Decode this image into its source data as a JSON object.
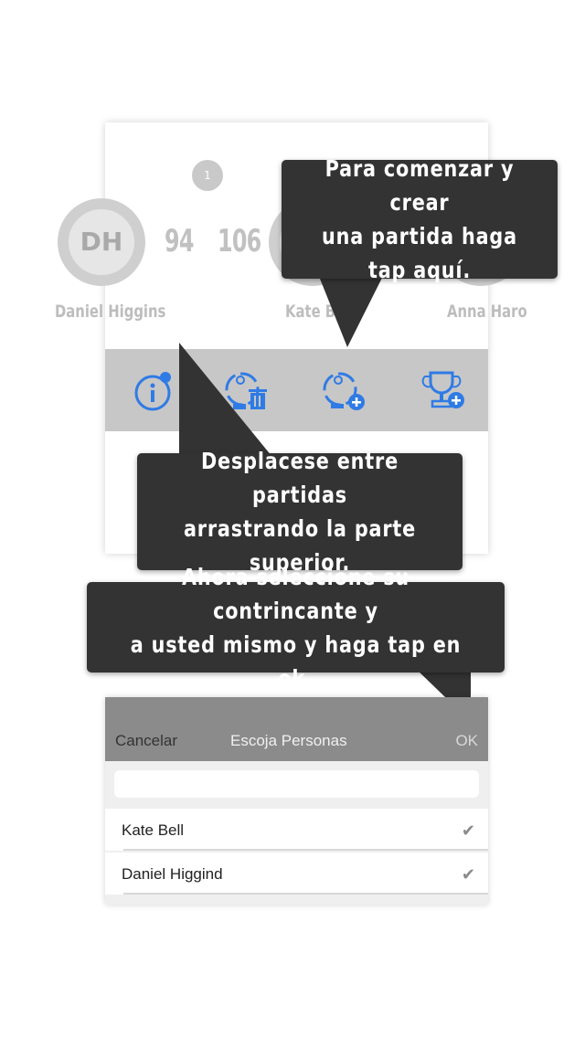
{
  "game": {
    "badge": "1",
    "players": [
      {
        "initials": "DH",
        "name": "Daniel Higgins"
      },
      {
        "initials": "",
        "name": "Kate Bell"
      },
      {
        "initials": "",
        "name": "Anna Haro"
      }
    ],
    "scores": [
      "94",
      "106"
    ]
  },
  "toolbar": {
    "icons": [
      "info-icon",
      "delete-game-icon",
      "add-game-icon",
      "add-trophy-icon"
    ],
    "accent": "#2f7be5"
  },
  "tips": {
    "create": "Para comenzar y crear\nuna partida haga tap aquí.",
    "scroll": "Desplacese entre partidas\narrastrando la parte superior.",
    "select": "Ahora seleccione su contrincante y\na usted mismo y haga tap en ok."
  },
  "picker": {
    "cancel": "Cancelar",
    "title": "Escoja Personas",
    "ok": "OK",
    "search_placeholder": "",
    "people": [
      {
        "name": "Kate Bell",
        "selected": true
      },
      {
        "name": "Daniel Higgind",
        "selected": true
      }
    ]
  },
  "colors": {
    "bubble": "#333333",
    "toolbar_bg": "#c7c7c7",
    "picker_header": "#8b8b8b"
  }
}
